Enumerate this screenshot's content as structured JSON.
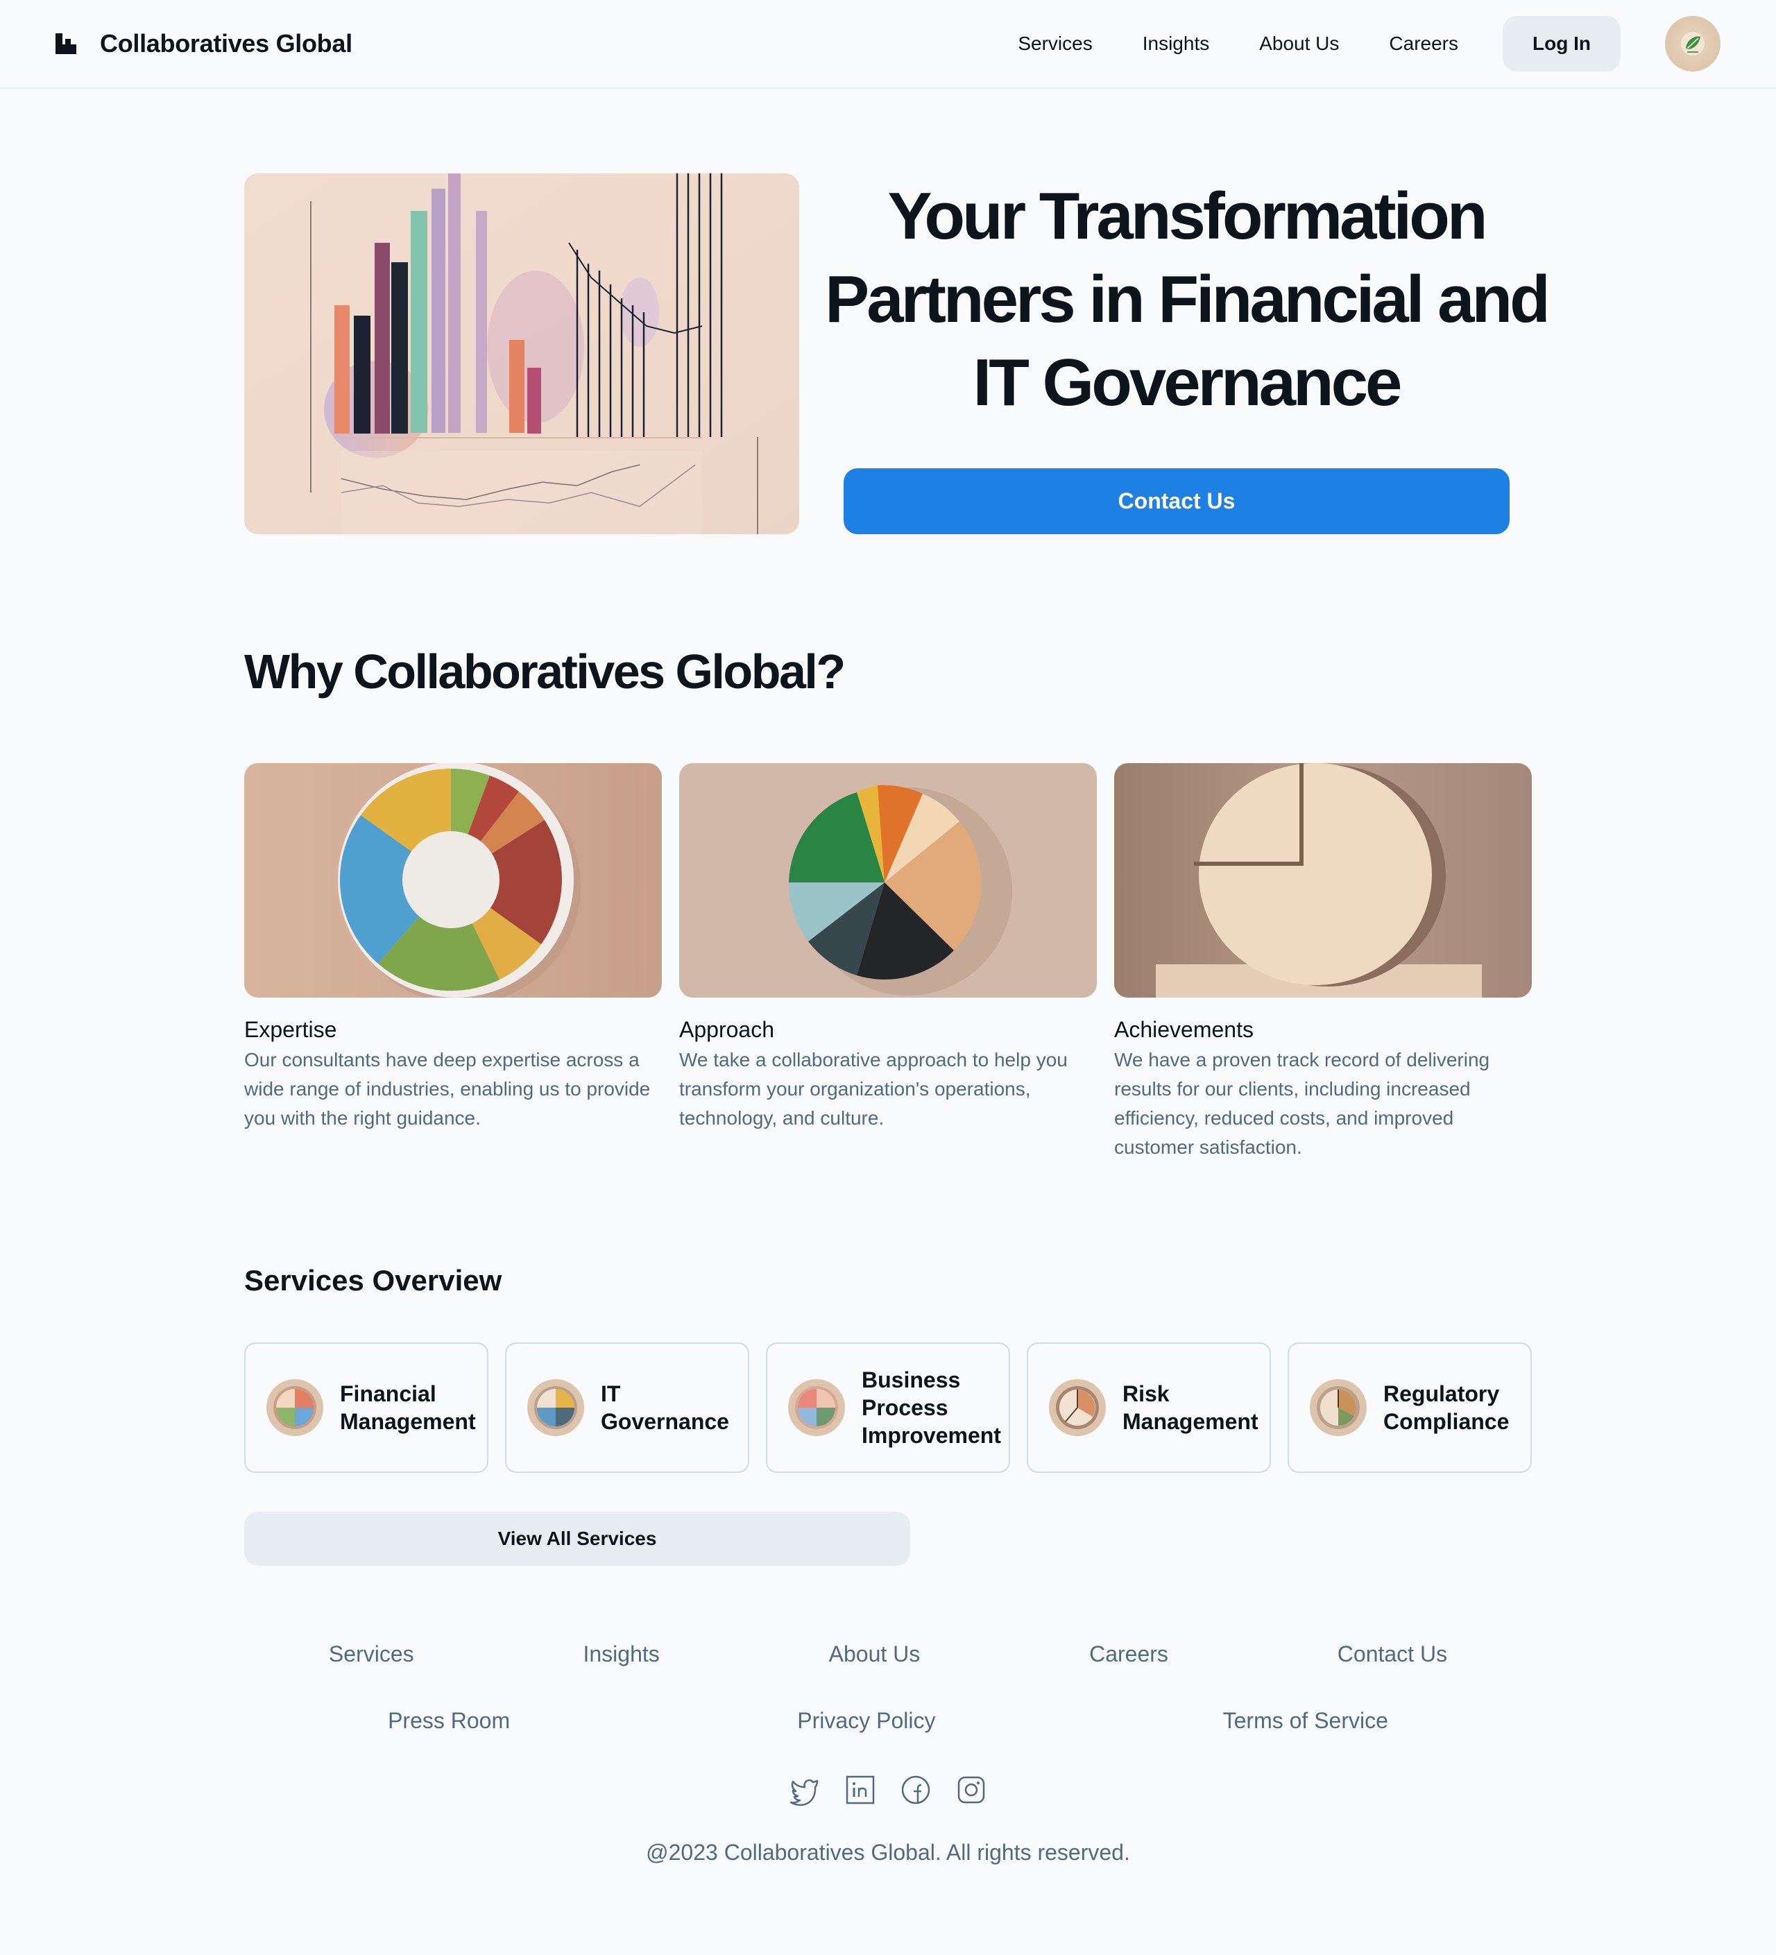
{
  "header": {
    "logo_title": "Collaboratives Global",
    "nav": [
      "Services",
      "Insights",
      "About Us",
      "Careers"
    ],
    "login_label": "Log In"
  },
  "hero": {
    "title": "Your Transformation Partners in Financial and IT Governance",
    "cta_label": "Contact Us"
  },
  "why": {
    "title": "Why Collaboratives Global?",
    "cards": [
      {
        "title": "Expertise",
        "text": "Our consultants have deep expertise across a wide range of industries, enabling us to provide you with the right guidance."
      },
      {
        "title": "Approach",
        "text": "We take a collaborative approach to help you transform your organization's operations, technology, and culture."
      },
      {
        "title": "Achievements",
        "text": "We have a proven track record of delivering results for our clients, including increased efficiency, reduced costs, and improved customer satisfaction."
      }
    ]
  },
  "services": {
    "title": "Services Overview",
    "items": [
      {
        "label": "Financial Management"
      },
      {
        "label": "IT Governance"
      },
      {
        "label": "Business Process Improvement"
      },
      {
        "label": "Risk Management"
      },
      {
        "label": "Regulatory Compliance"
      }
    ],
    "view_all_label": "View All Services"
  },
  "footer": {
    "row1": [
      "Services",
      "Insights",
      "About Us",
      "Careers",
      "Contact Us"
    ],
    "row2": [
      "Press Room",
      "Privacy Policy",
      "Terms of Service"
    ],
    "socials": [
      "twitter-icon",
      "linkedin-icon",
      "facebook-icon",
      "instagram-icon"
    ],
    "copyright": "@2023 Collaboratives Global. All rights reserved."
  },
  "colors": {
    "primary": "#1d80e2",
    "text": "#0e141b",
    "muted": "#4e6a87",
    "surface": "#e8edf2",
    "border": "#d1dbe6",
    "background": "#f8fafc"
  }
}
